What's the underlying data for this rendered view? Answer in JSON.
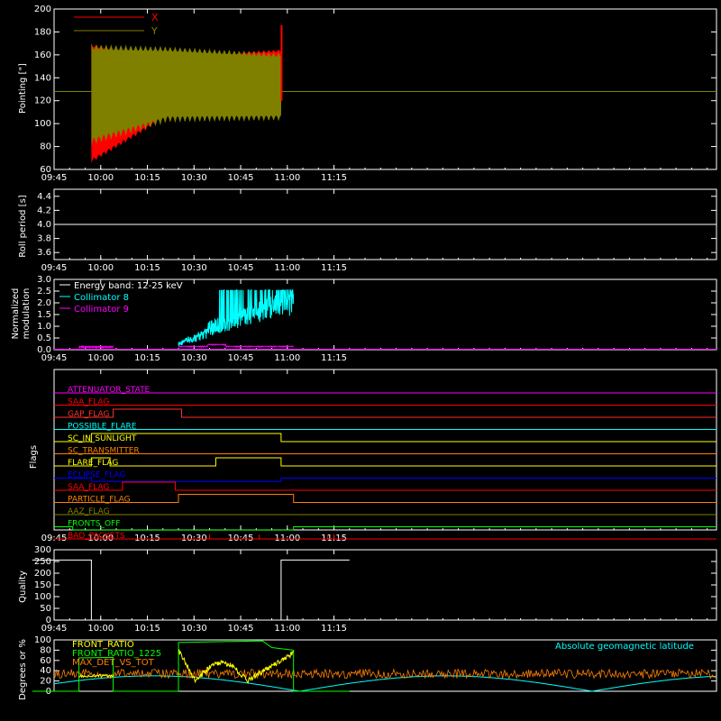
{
  "figure": {
    "background": "#000000",
    "axis_color": "#ffffff"
  },
  "chart_data": [
    {
      "id": "pointing",
      "type": "line",
      "ylabel": "Pointing [\"]",
      "ylim": [
        60,
        200
      ],
      "yticks": [
        60,
        80,
        100,
        120,
        140,
        160,
        180,
        200
      ],
      "xlim_minutes": [
        585,
        798
      ],
      "xticks": [
        "09:45",
        "10:00",
        "10:15",
        "10:30",
        "10:45",
        "11:00",
        "11:15"
      ],
      "legend": [
        {
          "name": "X",
          "color": "#ff0000"
        },
        {
          "name": "Y",
          "color": "#808000"
        }
      ],
      "series": [
        {
          "name": "X",
          "color": "#ff0000",
          "time_start": "09:57",
          "time_end": "10:58",
          "envelope_start": [
            65,
            170
          ],
          "envelope_mid": [
            105,
            160
          ],
          "envelope_end": [
            108,
            165
          ],
          "spike_end": 186
        },
        {
          "name": "Y",
          "color": "#808000",
          "time_start": "09:57",
          "time_end": "10:58",
          "envelope_start": [
            80,
            170
          ],
          "envelope_mid": [
            100,
            168
          ],
          "envelope_end": [
            102,
            162
          ],
          "baseline": 128
        }
      ]
    },
    {
      "id": "roll",
      "type": "line",
      "ylabel": "Roll period [s]",
      "ylim": [
        3.5,
        4.5
      ],
      "yticks": [
        3.6,
        3.8,
        4.0,
        4.2,
        4.4
      ],
      "series": [
        {
          "name": "",
          "color": "#ffffff",
          "x": [
            "09:38",
            "11:20"
          ],
          "y": [
            4.0,
            4.0
          ]
        }
      ]
    },
    {
      "id": "modulation",
      "type": "line",
      "ylabel": [
        "Normalized",
        "modulation"
      ],
      "ylim": [
        0,
        3.0
      ],
      "yticks": [
        0.0,
        0.5,
        1.0,
        1.5,
        2.0,
        2.5,
        3.0
      ],
      "legend": [
        {
          "name": "Energy band: 12-25 keV",
          "color": "#ffffff"
        },
        {
          "name": "Collimator 8",
          "color": "#00ffff"
        },
        {
          "name": "Collimator 9",
          "color": "#ff00ff"
        }
      ],
      "series": [
        {
          "name": "Collimator 8",
          "color": "#00ffff",
          "segment_start": "10:25",
          "segment_end": "11:02",
          "level_start": 0.3,
          "level_end": 2.55
        },
        {
          "name": "Collimator 9",
          "color": "#ff00ff",
          "segments": [
            [
              "09:53",
              "10:04",
              0.08
            ],
            [
              "10:25",
              "11:02",
              0.1
            ]
          ]
        }
      ]
    },
    {
      "id": "flags",
      "type": "line",
      "ylabel": "Flags",
      "flags": [
        {
          "name": "ATTENUATOR_STATE",
          "color": "#ff00ff",
          "steps": []
        },
        {
          "name": "SAA_FLAG",
          "color": "#ff0000",
          "steps": []
        },
        {
          "name": "GAP_FLAG",
          "color": "#ff3030",
          "steps": [
            [
              "10:04",
              "10:26"
            ]
          ]
        },
        {
          "name": "POSSIBLE_FLARE",
          "color": "#00ffff",
          "steps": []
        },
        {
          "name": "SC_IN_SUNLIGHT",
          "color": "#ffff00",
          "steps": [
            [
              "09:57",
              "10:58"
            ]
          ]
        },
        {
          "name": "SC_TRANSMITTER",
          "color": "#ff8000",
          "steps": []
        },
        {
          "name": "FLARE_FLAG",
          "color": "#ffff00",
          "steps": [
            [
              "09:57",
              "10:03"
            ],
            [
              "10:37",
              "10:58"
            ]
          ]
        },
        {
          "name": "ECLIPSE_FLAG",
          "color": "#0000ff",
          "steps_low": [
            [
              "09:57",
              "10:58"
            ]
          ]
        },
        {
          "name": "SAA_FLAG",
          "color": "#ff0000",
          "steps": [
            [
              "10:07",
              "10:24"
            ]
          ]
        },
        {
          "name": "PARTICLE_FLAG",
          "color": "#ff8000",
          "steps": [
            [
              "10:25",
              "11:02"
            ]
          ]
        },
        {
          "name": "AAZ_FLAG",
          "color": "#808000",
          "steps": []
        },
        {
          "name": "FRONTS_OFF",
          "color": "#00ff00",
          "steps_low": [
            [
              "09:51",
              "11:02"
            ]
          ]
        },
        {
          "name": "BAD_PACKETS",
          "color": "#ff0000",
          "ticks": [
            "10:35",
            "10:51",
            "11:13",
            "11:15"
          ]
        }
      ]
    },
    {
      "id": "quality",
      "type": "line",
      "ylabel": "Quality",
      "ylim": [
        0,
        300
      ],
      "yticks": [
        0,
        50,
        100,
        150,
        200,
        250,
        300
      ],
      "series": [
        {
          "name": "",
          "color": "#ffffff",
          "x": [
            "09:38",
            "09:57",
            "09:57",
            "10:58",
            "10:58",
            "11:20"
          ],
          "y": [
            256,
            256,
            0,
            0,
            256,
            256
          ]
        }
      ]
    },
    {
      "id": "geomag",
      "type": "line",
      "ylabel": "Degrees or %",
      "ylim": [
        0,
        100
      ],
      "yticks": [
        0,
        20,
        40,
        60,
        80,
        100
      ],
      "legend": [
        {
          "name": "FRONT_RATIO",
          "color": "#ffff00"
        },
        {
          "name": "FRONT_RATIO_1225",
          "color": "#00ff00"
        },
        {
          "name": "MAX_DET_VS_TOT",
          "color": "#ff8000"
        },
        {
          "name": "Absolute geomagnetic latitude",
          "color": "#00ffff"
        }
      ],
      "series": [
        {
          "name": "FRONT_RATIO",
          "color": "#ffff00"
        },
        {
          "name": "FRONT_RATIO_1225",
          "color": "#00ff00"
        },
        {
          "name": "MAX_DET_VS_TOT",
          "color": "#ff8000"
        },
        {
          "name": "Absolute geomagnetic latitude",
          "color": "#00ffff"
        }
      ]
    }
  ]
}
